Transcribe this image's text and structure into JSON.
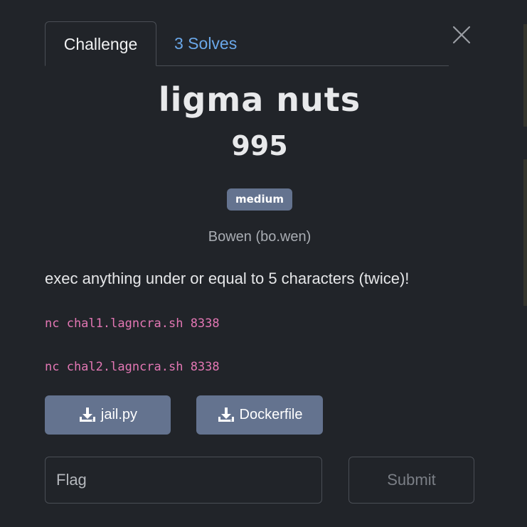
{
  "tabs": {
    "challenge_label": "Challenge",
    "solves_label": "3 Solves"
  },
  "challenge": {
    "name": "ligma nuts",
    "points": "995",
    "difficulty": "medium",
    "author": "Bowen (bo.wen)",
    "description": "exec anything under or equal to 5 characters (twice)!",
    "connections": [
      "nc chal1.lagncra.sh 8338",
      "nc chal2.lagncra.sh 8338"
    ]
  },
  "files": [
    {
      "label": "jail.py",
      "icon": "download-icon"
    },
    {
      "label": "Dockerfile",
      "icon": "download-icon"
    }
  ],
  "submission": {
    "placeholder": "Flag",
    "submit_label": "Submit"
  },
  "colors": {
    "background": "#212429",
    "badge": "#64738f",
    "link": "#6aa7e8",
    "code": "#e377b4"
  }
}
